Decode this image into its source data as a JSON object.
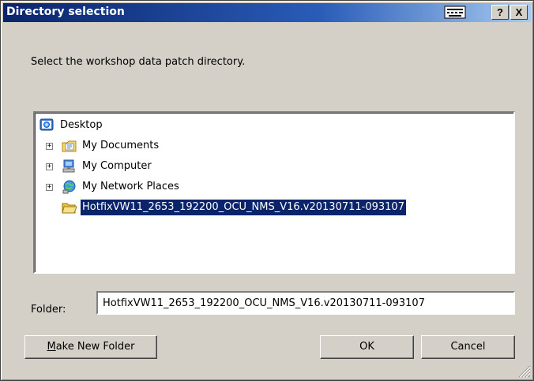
{
  "window": {
    "title": "Directory selection",
    "help_label": "?",
    "close_label": "X"
  },
  "prompt": "Select the workshop data patch directory.",
  "tree": {
    "items": [
      {
        "label": "Desktop",
        "icon": "desktop-icon"
      },
      {
        "label": "My Documents",
        "icon": "documents-folder-icon",
        "expander": "+"
      },
      {
        "label": "My Computer",
        "icon": "computer-icon",
        "expander": "+"
      },
      {
        "label": "My Network Places",
        "icon": "network-places-icon",
        "expander": "+"
      },
      {
        "label": "HotfixVW11_2653_192200_OCU_NMS_V16.v20130711-093107",
        "icon": "open-folder-icon",
        "selected": true
      }
    ]
  },
  "folder": {
    "label": "Folder:",
    "value": "HotfixVW11_2653_192200_OCU_NMS_V16.v20130711-093107"
  },
  "buttons": {
    "make_new_folder_prefix": "M",
    "make_new_folder_rest": "ake New Folder",
    "ok": "OK",
    "cancel": "Cancel"
  },
  "colors": {
    "title_start": "#0a246a",
    "title_end": "#a6caf0",
    "selection": "#0a246a",
    "face": "#d4d0c8"
  }
}
